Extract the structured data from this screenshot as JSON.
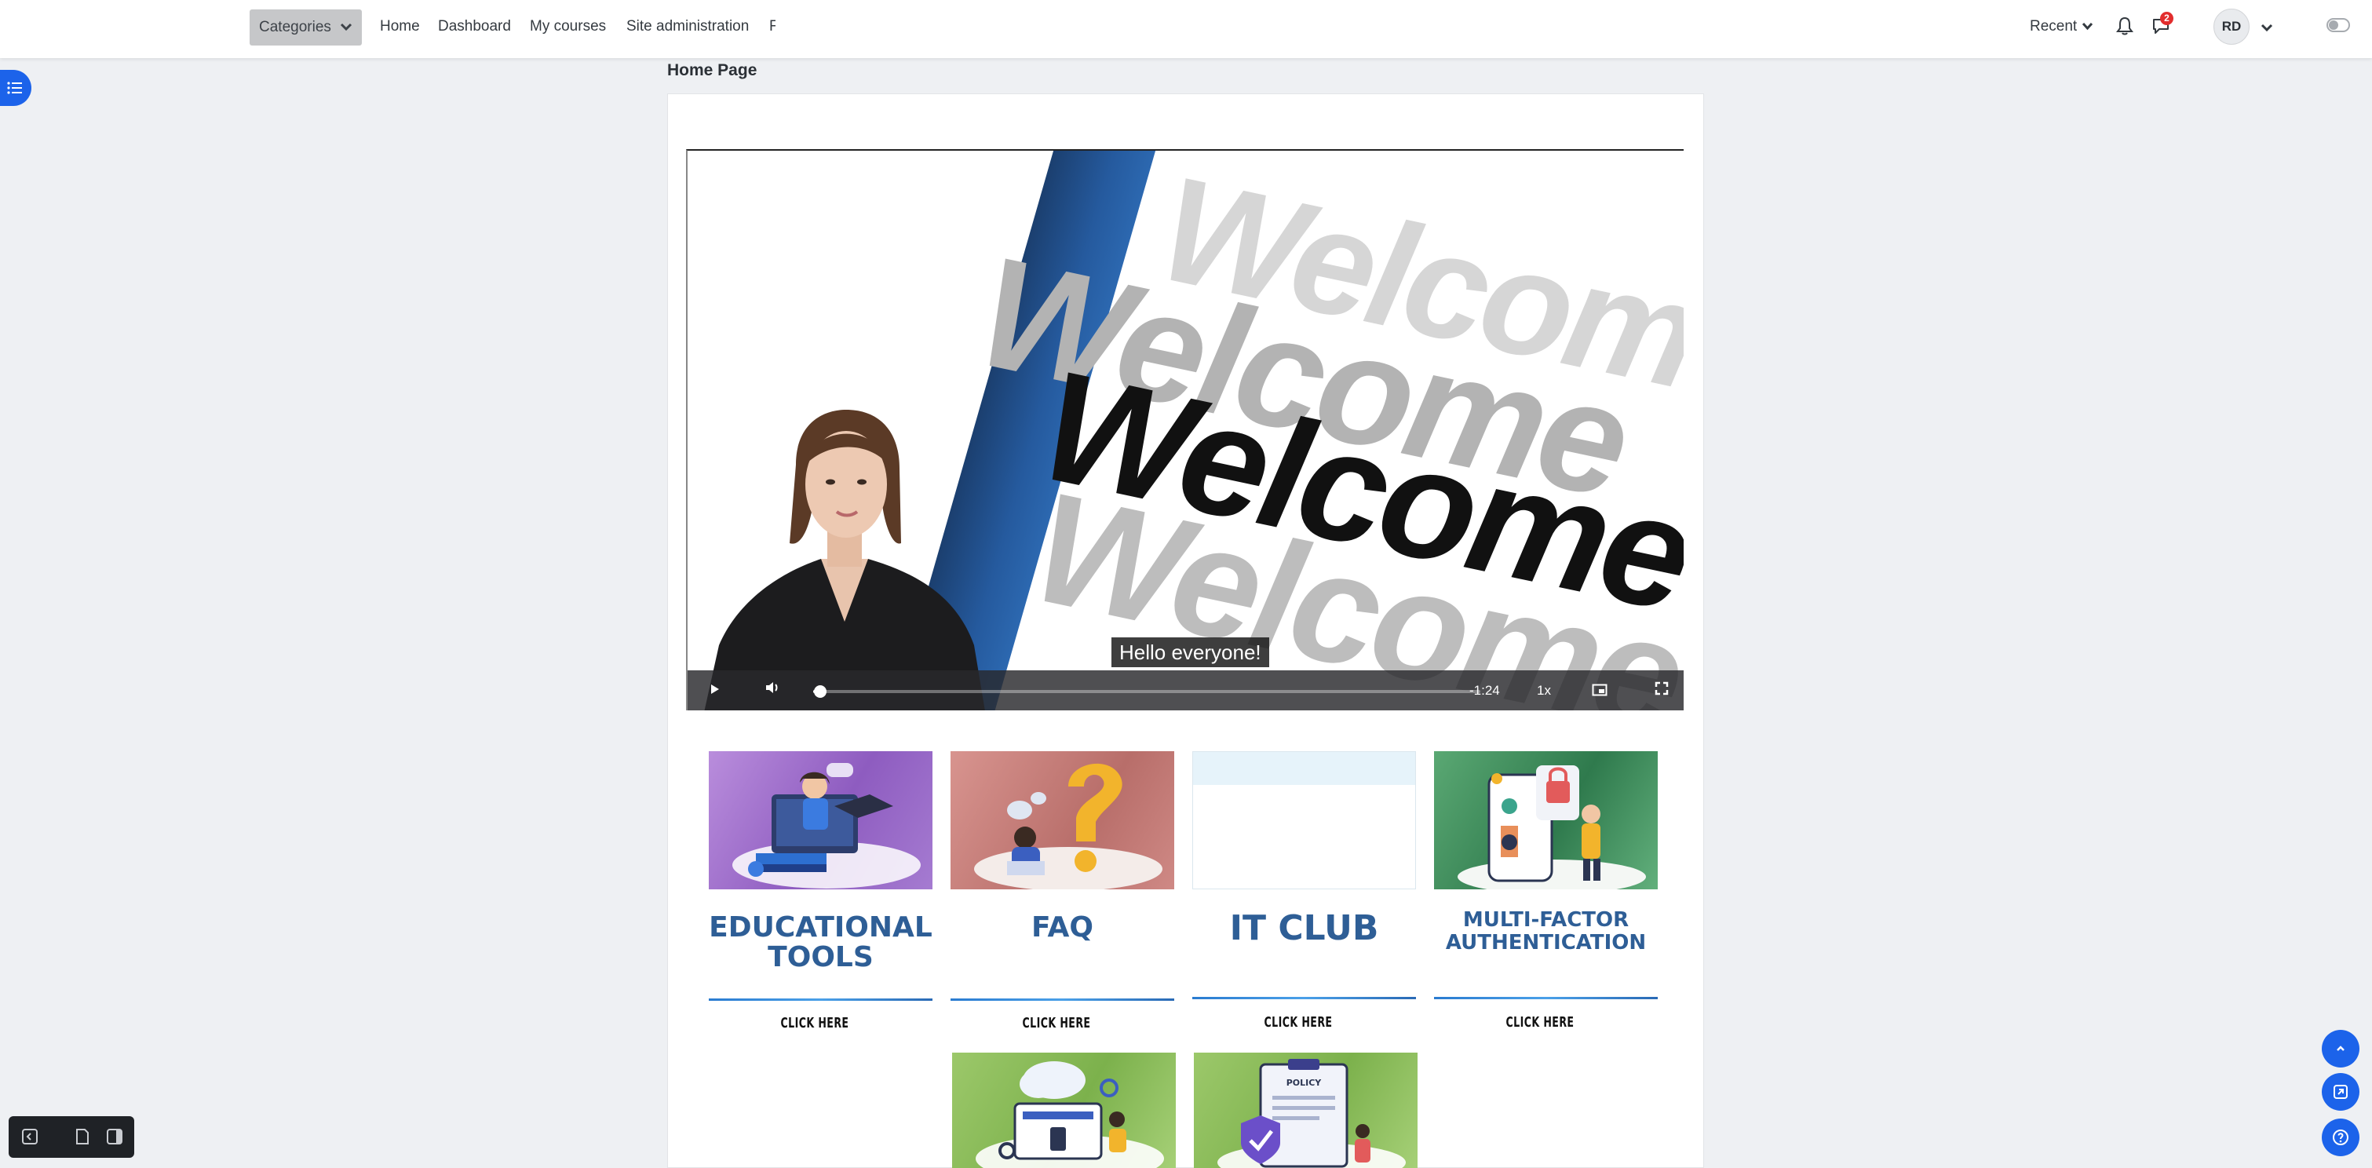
{
  "navbar": {
    "categories_label": "Categories",
    "items": [
      {
        "label": "Home"
      },
      {
        "label": "Dashboard"
      },
      {
        "label": "My courses"
      },
      {
        "label": "Site administration"
      },
      {
        "label": "F"
      }
    ],
    "recent_label": "Recent",
    "messages_badge": "2",
    "user_initials": "RD",
    "icons": {
      "notifications": "bell-icon",
      "messages": "chat-icon",
      "user_menu": "chevron-down-icon",
      "theme": "toggle-icon"
    }
  },
  "page": {
    "title": "Home Page"
  },
  "video": {
    "caption": "Hello everyone!",
    "background_word": "Welcome",
    "time_remaining": "-1:24",
    "speed": "1x",
    "progress_fraction": 0.01,
    "icons": {
      "play": "play-icon",
      "volume": "volume-icon",
      "pip": "picture-in-picture-icon",
      "fullscreen": "fullscreen-icon"
    }
  },
  "tiles": [
    {
      "title_line1": "EDUCATIONAL",
      "title_line2": "TOOLS",
      "link": "CLICK HERE",
      "image": "teacher-laptop-illustration",
      "bg": "#9d6fc5"
    },
    {
      "title_line1": "FAQ",
      "title_line2": "",
      "link": "CLICK HERE",
      "image": "question-mark-illustration",
      "bg": "#c97f7e"
    },
    {
      "title_line1": "IT CLUB",
      "title_line2": "",
      "link": "CLICK HERE",
      "image": "blank-image",
      "bg": "#e8f4fa"
    },
    {
      "title_line1": "MULTI-FACTOR",
      "title_line2": "AUTHENTICATION",
      "link": "CLICK HERE",
      "image": "phone-lock-illustration",
      "bg": "#3f8f5a"
    }
  ],
  "tiles_row2": [
    {
      "image": "cloud-computer-illustration"
    },
    {
      "image": "policy-document-illustration",
      "label": "POLICY"
    }
  ],
  "dock": {
    "icons": [
      "collapse-panel-icon",
      "page-icon",
      "sidebar-panel-icon"
    ]
  },
  "fabs": {
    "icons": [
      "chevron-up-icon",
      "expand-icon",
      "help-icon"
    ]
  },
  "colors": {
    "accent": "#1c63ea",
    "tile_title": "#2e5e96",
    "navbar_bg": "#ffffff",
    "page_bg": "#eef0f3"
  }
}
